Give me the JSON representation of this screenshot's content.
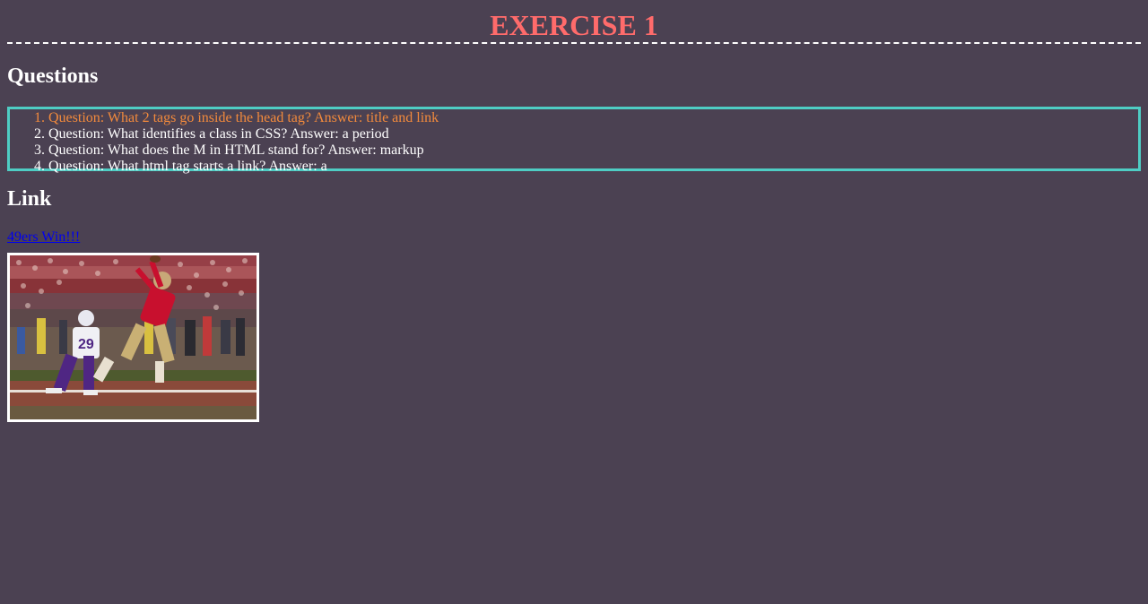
{
  "header": {
    "title": "EXERCISE 1"
  },
  "questions": {
    "heading": "Questions",
    "items": [
      "Question: What 2 tags go inside the head tag? Answer: title and link",
      "Question: What identifies a class in CSS? Answer: a period",
      "Question: What does the M in HTML stand for? Answer: markup",
      "Question: What html tag starts a link? Answer: a"
    ]
  },
  "link_section": {
    "heading": "Link",
    "link_text": "49ers Win!!!"
  },
  "image": {
    "alt": "49ers Win!!!",
    "depicts": "football receiver in red jersey catching ball in end zone while defender in purple jersey number 29 pursues, crowd in background"
  },
  "colors": {
    "background": "#4b4152",
    "title": "#ff6b6b",
    "highlight_item": "#f28a3c",
    "box_border": "#4ecdc4",
    "link": "#0000ee"
  }
}
